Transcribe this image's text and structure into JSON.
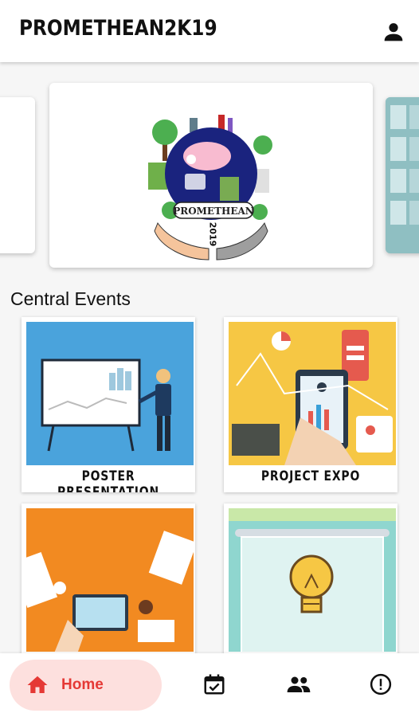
{
  "app_bar": {
    "title": "PROMETHEAN2K19",
    "account_icon": "account-icon"
  },
  "carousel": {
    "banner_text": "PROMETHEAN",
    "banner_year": "2019"
  },
  "section": {
    "title": "Central Events"
  },
  "events": [
    {
      "label": "POSTER PRESENTATION"
    },
    {
      "label": "PROJECT EXPO"
    },
    {
      "label": ""
    },
    {
      "label": ""
    }
  ],
  "bottom_nav": {
    "home_label": "Home",
    "items": [
      "home-icon",
      "calendar-check-icon",
      "people-icon",
      "info-icon"
    ],
    "accent": "#e53935"
  }
}
